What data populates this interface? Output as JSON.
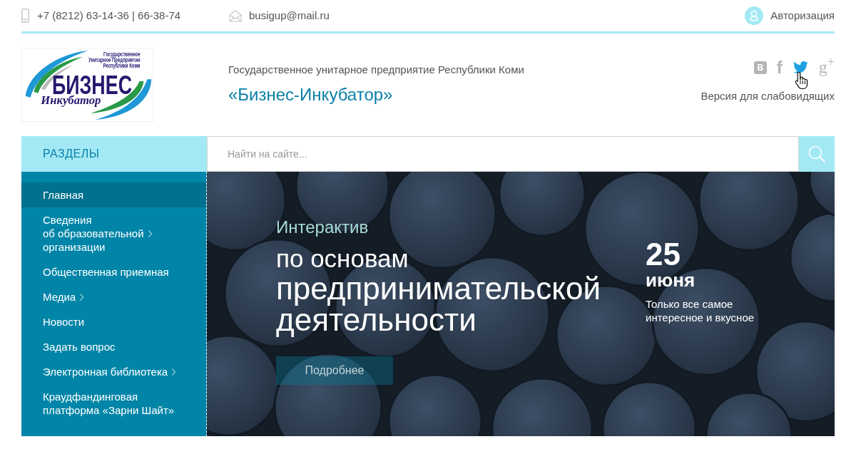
{
  "top_bar": {
    "phone": "+7 (8212) 63-14-36 | 66-38-74",
    "email": "busigup@mail.ru",
    "login": "Авторизация"
  },
  "header": {
    "logo": {
      "caption_lines": [
        "Государственное",
        "Унитарное Предприятие",
        "Республики Коми"
      ],
      "wordmark": "БИЗНЕС",
      "subtitle": "Инкубатор"
    },
    "org_type": "Государственное унитарное предприятие Республики Коми",
    "org_name": "«Бизнес-Инкубатор»",
    "social_links": [
      {
        "kind": "vk",
        "glyph": "В",
        "hovered": false
      },
      {
        "kind": "facebook",
        "glyph": "f",
        "hovered": false
      },
      {
        "kind": "twitter",
        "hovered": true
      },
      {
        "kind": "google_plus",
        "glyph": "g$^{+}$",
        "hovered": false
      }
    ],
    "accessibility_link": "Версия для слабовидящих"
  },
  "sidebar": {
    "title": "РАЗДЕЛЫ",
    "items": [
      {
        "label": "Главная",
        "selected": true,
        "has_submenu": false
      },
      {
        "label": "Сведения\nоб образовательной\nорганизации",
        "selected": false,
        "has_submenu": true
      },
      {
        "label": "Общественная приемная",
        "selected": false,
        "has_submenu": false
      },
      {
        "label": "Медиа",
        "selected": false,
        "has_submenu": true
      },
      {
        "label": "Новости",
        "selected": false,
        "has_submenu": false
      },
      {
        "label": "Задать вопрос",
        "selected": false,
        "has_submenu": false
      },
      {
        "label": "Электронная библиотека",
        "selected": false,
        "has_submenu": true
      },
      {
        "label": "Краудфандинговая\nплатформа «Зарни Шайт»",
        "selected": false,
        "has_submenu": false
      }
    ]
  },
  "search": {
    "placeholder": "Найти на сайте..."
  },
  "banner": {
    "category": "Интерактив",
    "title_lead": "по основам",
    "title": "предпринимательской деятельности",
    "day": "25",
    "month": "июня",
    "tagline": "Только все самое интересное и вкусное",
    "button": "Подробнее"
  }
}
